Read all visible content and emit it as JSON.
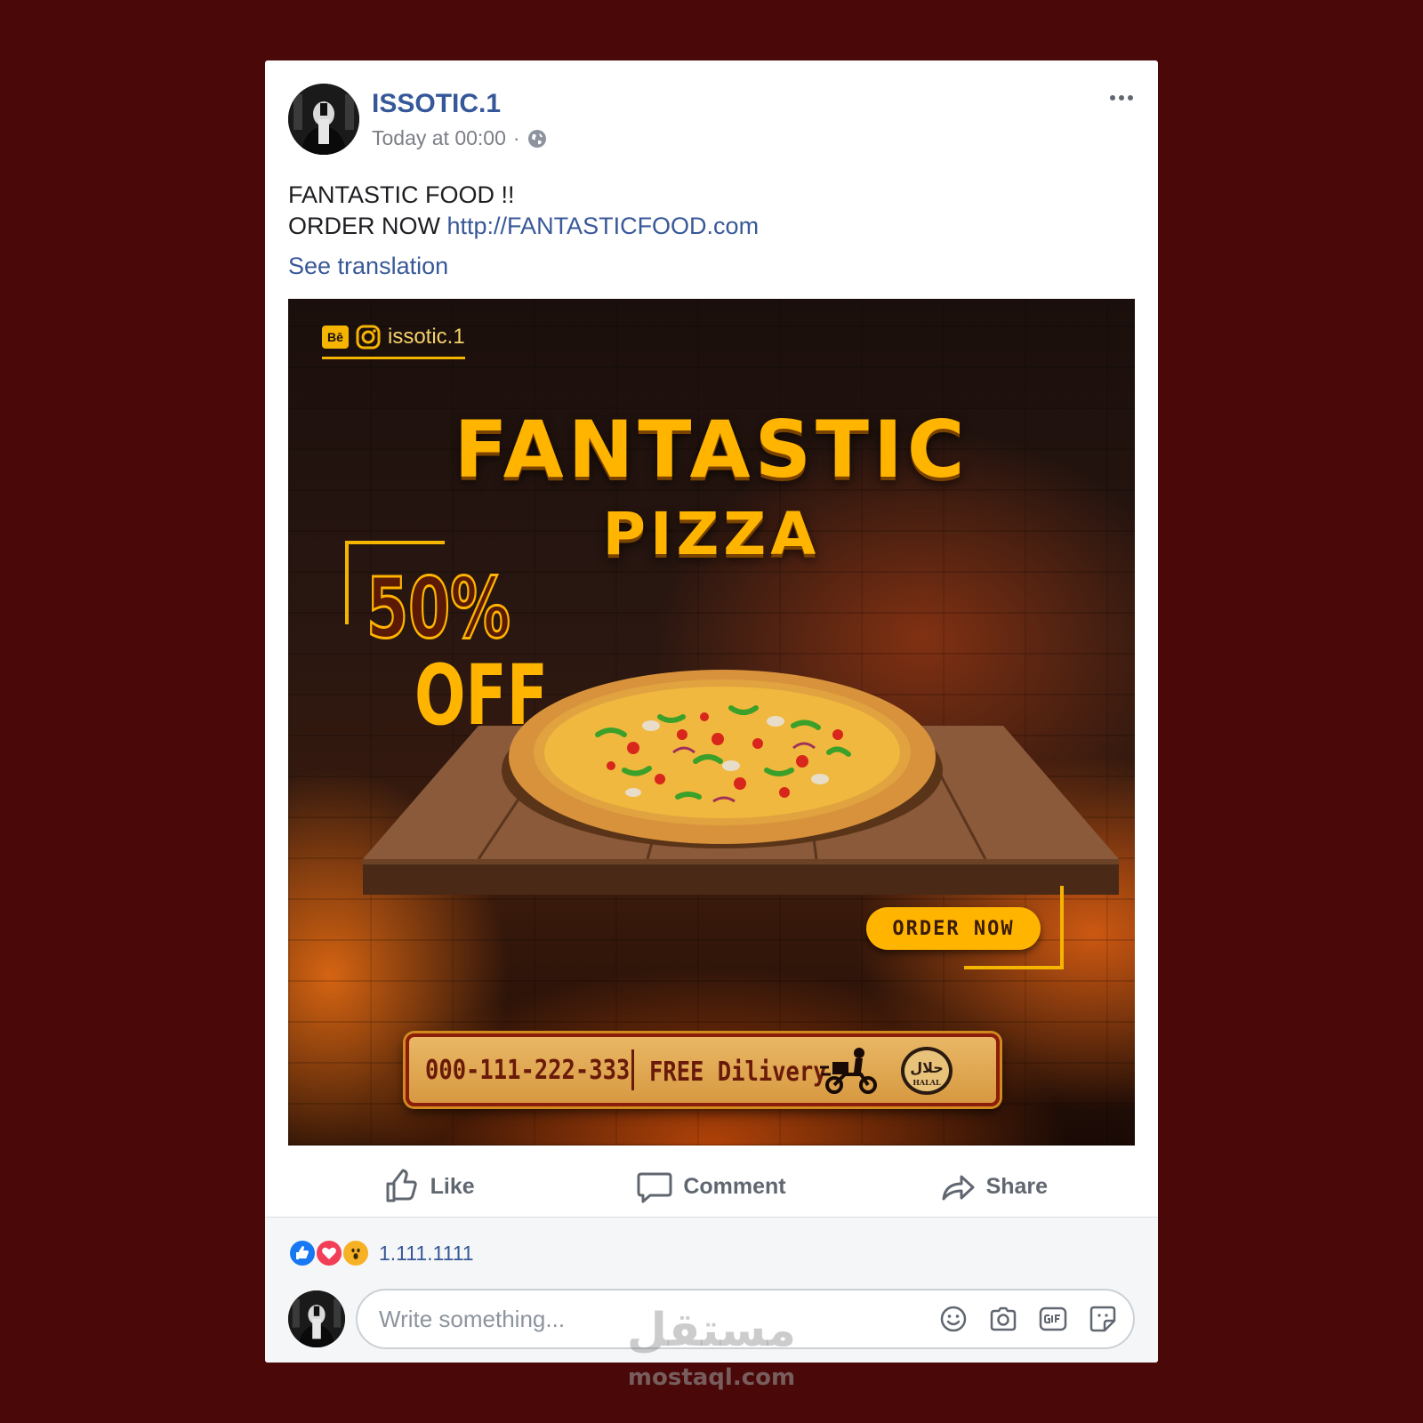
{
  "post": {
    "author": "ISSOTIC.1",
    "timestamp": "Today at 00:00",
    "separator": "·",
    "privacy_icon": "globe-icon",
    "more_icon": "more-horizontal-icon",
    "text_line1": "FANTASTIC FOOD !!",
    "text_line2_prefix": "ORDER NOW",
    "link": "http://FANTASTICFOOD.com",
    "see_translation": "See translation"
  },
  "ad": {
    "social_handle": "issotic.1",
    "behance_label": "Bē",
    "title_line1": "FANTASTIC",
    "title_line2": "PIZZA",
    "discount": "50%",
    "discount_suffix": "OFF",
    "cta": "ORDER NOW",
    "phone": "000-111-222-333",
    "delivery": "FREE Dilivery",
    "halal_arabic": "حلال",
    "halal_latin": "HALAL",
    "accent_color": "#ffb400"
  },
  "actions": {
    "like": "Like",
    "comment": "Comment",
    "share": "Share"
  },
  "reactions": {
    "types": [
      "like",
      "love",
      "wow"
    ],
    "count": "1.111.1111"
  },
  "comment_box": {
    "placeholder": "Write something...",
    "icons": [
      "emoji-icon",
      "camera-icon",
      "gif-icon",
      "sticker-icon"
    ]
  },
  "watermark": {
    "arabic": "مستقل",
    "latin": "mostaql.com"
  },
  "colors": {
    "background": "#4a0808",
    "link": "#385898",
    "author": "#365899"
  }
}
